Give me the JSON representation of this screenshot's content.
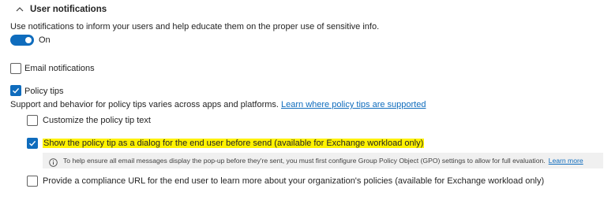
{
  "section": {
    "title": "User notifications",
    "description": "Use notifications to inform your users and help educate them on the proper use of sensitive info."
  },
  "toggle": {
    "label": "On",
    "state": true
  },
  "email_notifications": {
    "label": "Email notifications",
    "checked": false
  },
  "policy_tips": {
    "label": "Policy tips",
    "checked": true,
    "description": "Support and behavior for policy tips varies across apps and platforms.",
    "link": "Learn where policy tips are supported",
    "options": {
      "customize": {
        "label": "Customize the policy tip text",
        "checked": false
      },
      "dialog": {
        "label": "Show the policy tip as a dialog for the end user before send (available for Exchange workload only)",
        "checked": true
      },
      "compliance_url": {
        "label": "Provide a compliance URL for the end user to learn more about your organization's policies (available for Exchange workload only)",
        "checked": false
      }
    }
  },
  "info": {
    "icon": "info-icon",
    "text": "To help ensure all email messages display the pop-up before they're sent, you must first configure Group Policy Object (GPO) settings to allow for full evaluation.",
    "link": "Learn more"
  },
  "colors": {
    "accent": "#0f6cbd",
    "highlight": "#fff200",
    "info_bg": "#f0f0f0"
  }
}
